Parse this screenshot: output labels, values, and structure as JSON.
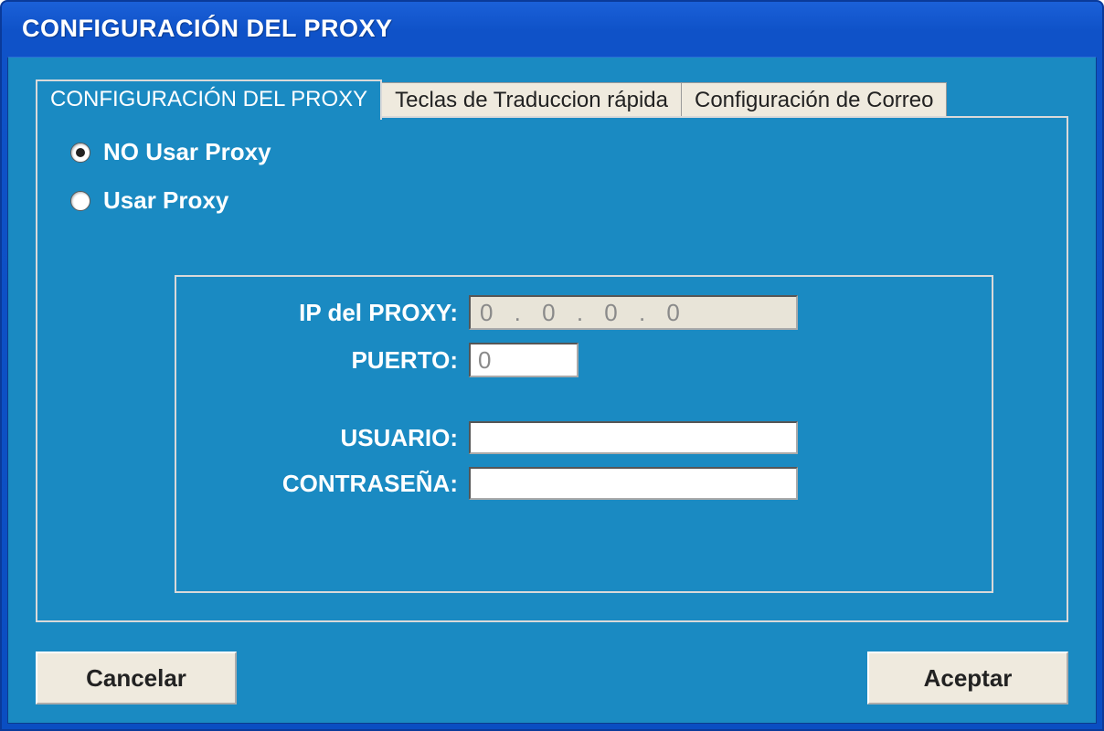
{
  "window": {
    "title": "CONFIGURACIÓN DEL PROXY"
  },
  "tabs": [
    {
      "label": "CONFIGURACIÓN DEL PROXY",
      "active": true
    },
    {
      "label": "Teclas de Traduccion rápida",
      "active": false
    },
    {
      "label": "Configuración de Correo",
      "active": false
    }
  ],
  "radios": {
    "no_proxy": {
      "label": "NO Usar Proxy",
      "checked": true
    },
    "use_proxy": {
      "label": "Usar Proxy",
      "checked": false
    }
  },
  "fields": {
    "ip": {
      "label": "IP del PROXY:",
      "value": "0 . 0 . 0 . 0"
    },
    "port": {
      "label": "PUERTO:",
      "value": "0"
    },
    "user": {
      "label": "USUARIO:",
      "value": ""
    },
    "password": {
      "label": "CONTRASEÑA:",
      "value": ""
    }
  },
  "buttons": {
    "cancel": "Cancelar",
    "accept": "Aceptar"
  }
}
